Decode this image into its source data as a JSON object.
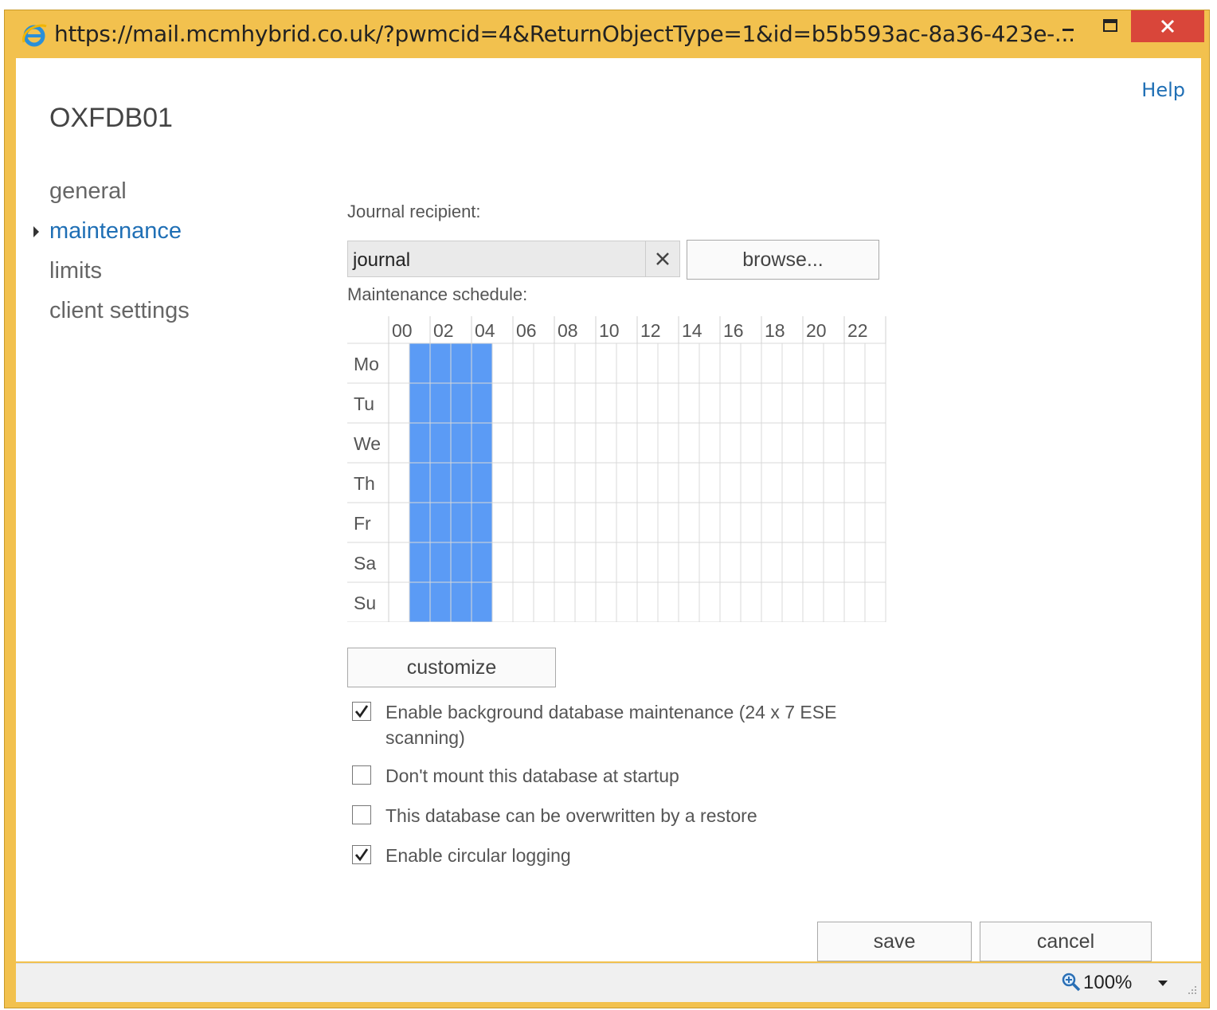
{
  "window": {
    "url": "https://mail.mcmhybrid.co.uk/?pwmcid=4&ReturnObjectType=1&id=b5b593ac-8a36-423e-...",
    "minimize_icon": "minimize-icon",
    "maximize_icon": "maximize-icon",
    "close_icon": "close-icon"
  },
  "help_label": "Help",
  "object_title": "OXFDB01",
  "nav": {
    "items": [
      {
        "label": "general"
      },
      {
        "label": "maintenance",
        "active": true
      },
      {
        "label": "limits"
      },
      {
        "label": "client settings"
      }
    ]
  },
  "journal": {
    "label": "Journal recipient:",
    "value": "journal",
    "clear_icon": "clear-icon",
    "browse_label": "browse..."
  },
  "schedule": {
    "label": "Maintenance schedule:",
    "hour_labels": [
      "00",
      "02",
      "04",
      "06",
      "08",
      "10",
      "12",
      "14",
      "16",
      "18",
      "20",
      "22"
    ],
    "days": [
      "Mo",
      "Tu",
      "We",
      "Th",
      "Fr",
      "Sa",
      "Su"
    ],
    "selected_start_hour": 1,
    "selected_end_hour": 5,
    "selected_color": "#5b9bf5"
  },
  "customize_label": "customize",
  "options": [
    {
      "label": "Enable background database maintenance (24 x 7 ESE scanning)",
      "checked": true
    },
    {
      "label": "Don't mount this database at startup",
      "checked": false
    },
    {
      "label": "This database can be overwritten by a restore",
      "checked": false
    },
    {
      "label": "Enable circular logging",
      "checked": true
    }
  ],
  "save_label": "save",
  "cancel_label": "cancel",
  "status": {
    "zoom": "100%"
  },
  "colors": {
    "frame": "#f2c14e",
    "close_button": "#d9463a",
    "link": "#1f6fb5"
  }
}
